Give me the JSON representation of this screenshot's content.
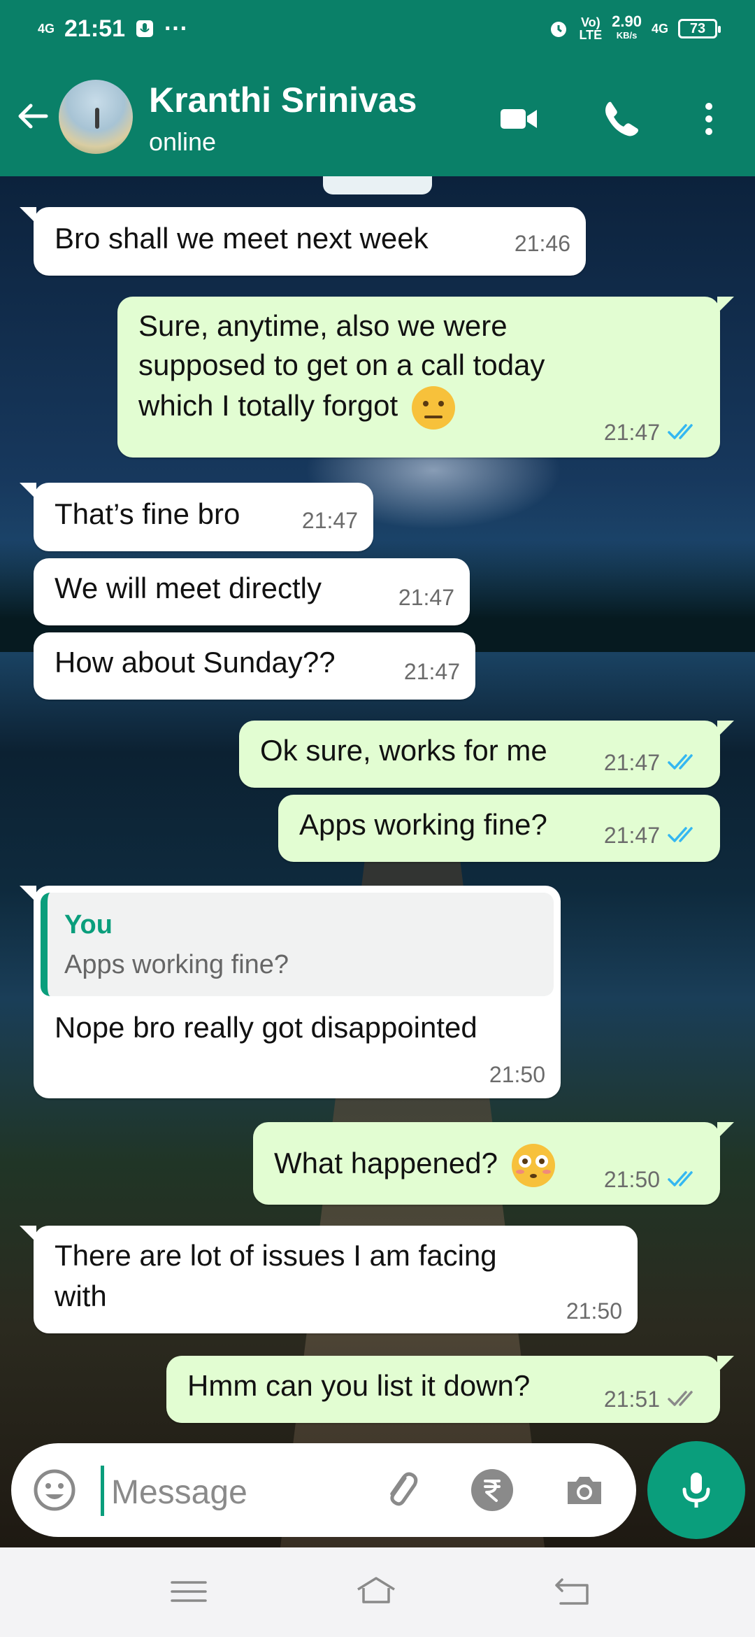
{
  "status_bar": {
    "network_left": "4G",
    "time": "21:51",
    "more": "···",
    "volte_top": "Vo)",
    "volte_bottom": "LTE",
    "speed_value": "2.90",
    "speed_unit": "KB/s",
    "network_right": "4G",
    "battery": "73"
  },
  "header": {
    "contact_name": "Kranthi Srinivas",
    "contact_status": "online"
  },
  "messages": [
    {
      "dir": "in",
      "text": "Bro shall we meet next week",
      "time": "21:46"
    },
    {
      "dir": "out",
      "lines": [
        "Sure, anytime, also we were",
        "supposed to get on a call today",
        "which I totally forgot"
      ],
      "emoji": "neutral-face",
      "time": "21:47",
      "ticks": "read"
    },
    {
      "dir": "in",
      "text": "That’s fine bro",
      "time": "21:47"
    },
    {
      "dir": "in",
      "text": "We will meet directly",
      "time": "21:47"
    },
    {
      "dir": "in",
      "text": "How about Sunday??",
      "time": "21:47"
    },
    {
      "dir": "out",
      "text": "Ok sure, works for me",
      "time": "21:47",
      "ticks": "read"
    },
    {
      "dir": "out",
      "text": "Apps working fine?",
      "time": "21:47",
      "ticks": "read"
    },
    {
      "dir": "in",
      "quote_author": "You",
      "quote_text": "Apps working fine?",
      "text": "Nope bro really got disappointed",
      "time": "21:50"
    },
    {
      "dir": "out",
      "text": "What happened?",
      "emoji": "flushed-face",
      "time": "21:50",
      "ticks": "read"
    },
    {
      "dir": "in",
      "lines": [
        "There are lot of issues I am facing",
        "with"
      ],
      "time": "21:50"
    },
    {
      "dir": "out",
      "text": "Hmm can you list it down?",
      "time": "21:51",
      "ticks": "delivered"
    }
  ],
  "composer": {
    "placeholder": "Message"
  },
  "colors": {
    "header_green": "#0a8068",
    "accent_green": "#0a9e7c",
    "outgoing_bubble": "#e2fdd2",
    "incoming_bubble": "#ffffff",
    "read_tick": "#34b7f1",
    "delivered_tick": "#8a8a8a"
  },
  "icons": {
    "back": "arrow-left-icon",
    "video": "video-call-icon",
    "call": "phone-icon",
    "menu": "more-vertical-icon",
    "emoji": "emoji-icon",
    "attach": "paperclip-icon",
    "payment": "rupee-icon",
    "camera": "camera-icon",
    "mic": "microphone-icon"
  }
}
